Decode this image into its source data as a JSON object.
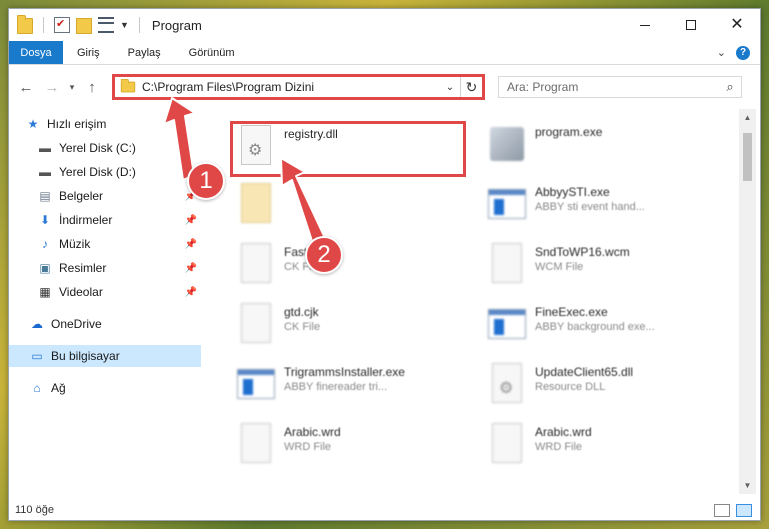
{
  "window": {
    "title": "Program"
  },
  "ribbon": {
    "tabs": [
      "Dosya",
      "Giriş",
      "Paylaş",
      "Görünüm"
    ]
  },
  "address": {
    "path": "C:\\Program Files\\Program Dizini"
  },
  "search": {
    "placeholder": "Ara: Program"
  },
  "sidebar": {
    "items": [
      {
        "label": "Hızlı erişim",
        "icon": "star-icon",
        "pinned": false
      },
      {
        "label": "Yerel Disk (C:)",
        "icon": "drive-icon",
        "pinned": false
      },
      {
        "label": "Yerel Disk (D:)",
        "icon": "drive-icon",
        "pinned": false
      },
      {
        "label": "Belgeler",
        "icon": "documents-icon",
        "pinned": true
      },
      {
        "label": "İndirmeler",
        "icon": "download-icon",
        "pinned": true
      },
      {
        "label": "Müzik",
        "icon": "music-icon",
        "pinned": true
      },
      {
        "label": "Resimler",
        "icon": "pictures-icon",
        "pinned": true
      },
      {
        "label": "Videolar",
        "icon": "video-icon",
        "pinned": true
      },
      {
        "label": "OneDrive",
        "icon": "cloud-icon",
        "pinned": false
      },
      {
        "label": "Bu bilgisayar",
        "icon": "computer-icon",
        "pinned": false,
        "selected": true
      },
      {
        "label": "Ağ",
        "icon": "network-icon",
        "pinned": false
      }
    ]
  },
  "files": [
    {
      "name": "registry.dll",
      "type": "",
      "icon": "dll-file-icon"
    },
    {
      "name": "program.exe",
      "type": "",
      "icon": "app-icon"
    },
    {
      "name": "",
      "type": "",
      "icon": "folder-icon"
    },
    {
      "name": "AbbyySTI.exe",
      "type": "ABBY sti event hand...",
      "icon": "app-icon"
    },
    {
      "name": "FastN...",
      "type": "CK File",
      "icon": "file-icon"
    },
    {
      "name": "SndToWP16.wcm",
      "type": "WCM File",
      "icon": "file-icon"
    },
    {
      "name": "gtd.cjk",
      "type": "CK File",
      "icon": "file-icon"
    },
    {
      "name": "FineExec.exe",
      "type": "ABBY background exe...",
      "icon": "app-icon"
    },
    {
      "name": "TrigrammsInstaller.exe",
      "type": "ABBY finereader tri...",
      "icon": "app-icon"
    },
    {
      "name": "UpdateClient65.dll",
      "type": "Resource DLL",
      "icon": "dll-file-icon"
    },
    {
      "name": "Arabic.wrd",
      "type": "WRD File",
      "icon": "file-icon"
    },
    {
      "name": "Arabic.wrd",
      "type": "WRD File",
      "icon": "file-icon"
    }
  ],
  "status": {
    "count": "110 öğe"
  },
  "annotations": {
    "badge1": "1",
    "badge2": "2",
    "color": "#e04848"
  }
}
